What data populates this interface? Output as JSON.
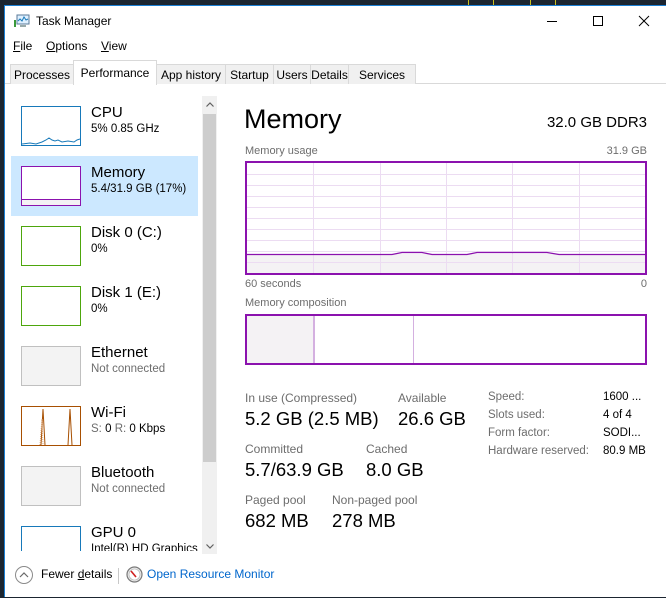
{
  "window": {
    "title": "Task Manager",
    "controls": {
      "minimize": "minimize",
      "maximize": "maximize",
      "close": "close"
    }
  },
  "menu": [
    {
      "label": "File",
      "accel": "F",
      "rest": "ile"
    },
    {
      "label": "Options",
      "accel": "O",
      "rest": "ptions"
    },
    {
      "label": "View",
      "accel": "V",
      "rest": "iew"
    }
  ],
  "tabs": [
    {
      "label": "Processes",
      "active": false
    },
    {
      "label": "Performance",
      "active": true
    },
    {
      "label": "App history",
      "active": false
    },
    {
      "label": "Startup",
      "active": false
    },
    {
      "label": "Users",
      "active": false
    },
    {
      "label": "Details",
      "active": false
    },
    {
      "label": "Services",
      "active": false
    }
  ],
  "sidebar": {
    "items": [
      {
        "name": "CPU",
        "sub": "5% 0.85 GHz",
        "sub_style": "normal",
        "color": "#1779ba",
        "selected": false
      },
      {
        "name": "Memory",
        "sub": "5.4/31.9 GB (17%)",
        "sub_style": "normal",
        "color": "#8b12ae",
        "selected": true
      },
      {
        "name": "Disk 0 (C:)",
        "sub": "0%",
        "sub_style": "normal",
        "color": "#4da60c",
        "selected": false
      },
      {
        "name": "Disk 1 (E:)",
        "sub": "0%",
        "sub_style": "normal",
        "color": "#4da60c",
        "selected": false
      },
      {
        "name": "Ethernet",
        "sub": "Not connected",
        "sub_style": "gray",
        "color": "#c0c0c0",
        "selected": false
      },
      {
        "name": "Wi-Fi",
        "sub_s_label": "S:",
        "sub_s_val": "0",
        "sub_r_label": "R:",
        "sub_r_val": "0 Kbps",
        "sub_style": "wifi",
        "color": "#a74f01",
        "selected": false
      },
      {
        "name": "Bluetooth",
        "sub": "Not connected",
        "sub_style": "gray",
        "color": "#c0c0c0",
        "selected": false
      },
      {
        "name": "GPU 0",
        "sub": "Intel(R) HD Graphics",
        "sub_style": "normal",
        "color": "#1779ba",
        "selected": false
      }
    ]
  },
  "main": {
    "title": "Memory",
    "spec": "32.0 GB DDR3",
    "usage_label": "Memory usage",
    "usage_max": "31.9 GB",
    "time_left": "60 seconds",
    "time_right": "0",
    "composition_label": "Memory composition",
    "composition": {
      "in_use_fraction": 0.17,
      "modified_fraction": 0.002,
      "standby_fraction": 0.25,
      "free_fraction": 0.578
    },
    "usage_fraction": 0.17,
    "stats": {
      "in_use_label": "In use (Compressed)",
      "in_use_value": "5.2 GB (2.5 MB)",
      "available_label": "Available",
      "available_value": "26.6 GB",
      "committed_label": "Committed",
      "committed_value": "5.7/63.9 GB",
      "cached_label": "Cached",
      "cached_value": "8.0 GB",
      "paged_label": "Paged pool",
      "paged_value": "682 MB",
      "nonpaged_label": "Non-paged pool",
      "nonpaged_value": "278 MB"
    },
    "details": [
      {
        "key": "Speed:",
        "value": "1600 ..."
      },
      {
        "key": "Slots used:",
        "value": "4 of 4"
      },
      {
        "key": "Form factor:",
        "value": "SODI..."
      },
      {
        "key": "Hardware reserved:",
        "value": "80.9 MB"
      }
    ]
  },
  "footer": {
    "fewer_details_pre": "Fewer ",
    "fewer_details_accel": "d",
    "fewer_details_post": "etails",
    "fewer_details": "Fewer details",
    "open_resource_monitor": "Open Resource Monitor"
  },
  "colors": {
    "memory_accent": "#8b12ae",
    "grid": "#ecdcf2",
    "fill": "#f4f2f4",
    "selection": "#cce8ff",
    "link": "#0066cc"
  }
}
